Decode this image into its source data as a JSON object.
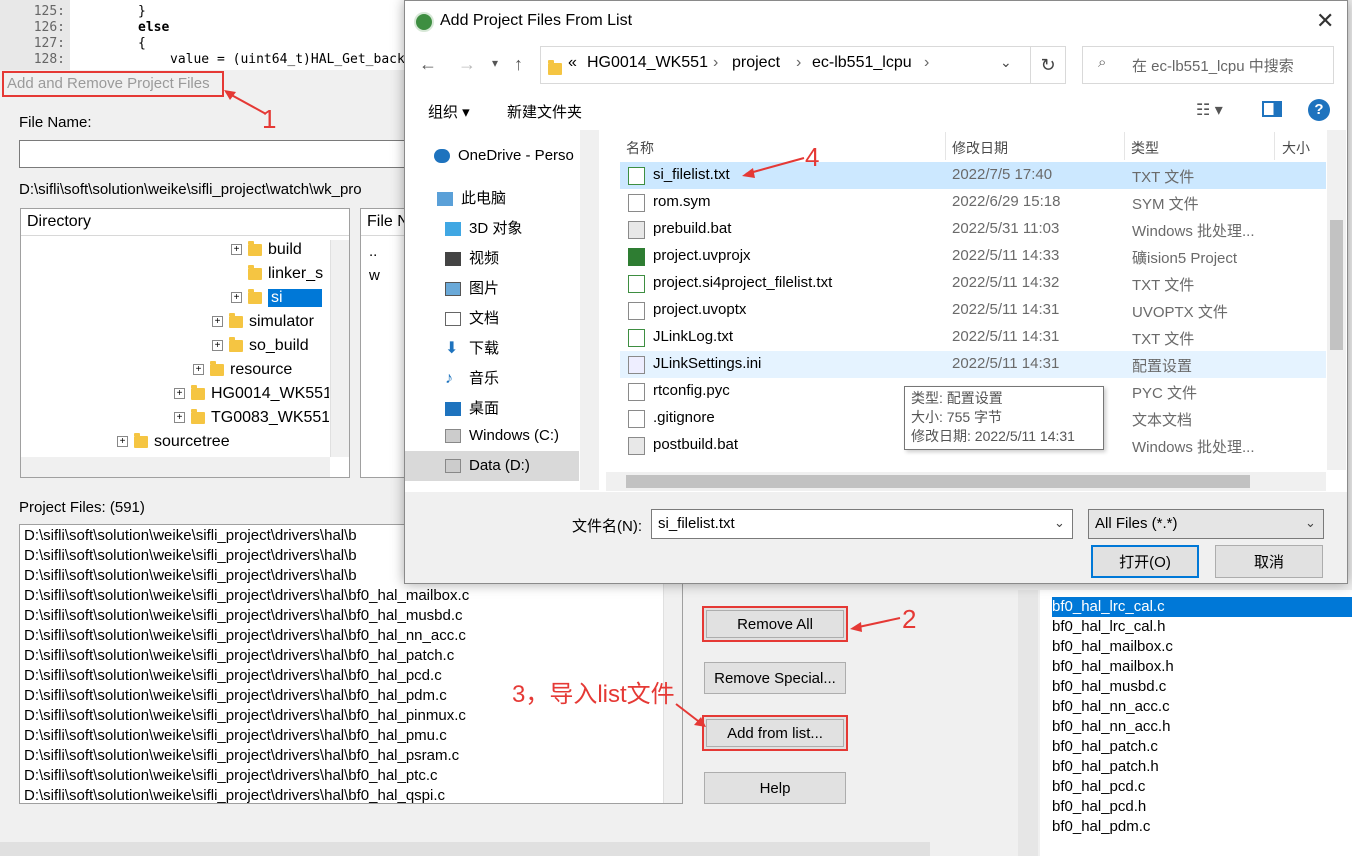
{
  "editor": {
    "lines": [
      {
        "num": "125:",
        "code": "}"
      },
      {
        "num": "126:",
        "code": "else"
      },
      {
        "num": "127:",
        "code": "{"
      },
      {
        "num": "128:",
        "code": "value = (uint64_t)HAL_Get_backu"
      }
    ]
  },
  "main_dialog": {
    "title": "Add and Remove Project Files",
    "file_name_label": "File Name:",
    "file_name_value": "",
    "path": "D:\\sifli\\soft\\solution\\weike\\sifli_project\\watch\\wk_pro",
    "directory_header": "Directory",
    "file_header": "File N",
    "tree": [
      {
        "label": "build",
        "expander": "+"
      },
      {
        "label": "linker_s",
        "expander": ""
      },
      {
        "label": "si",
        "expander": "+",
        "selected": true
      },
      {
        "label": "simulator",
        "expander": "+"
      },
      {
        "label": "so_build",
        "expander": "+"
      },
      {
        "label": "resource",
        "expander": "+"
      },
      {
        "label": "HG0014_WK551",
        "expander": "+"
      },
      {
        "label": "TG0083_WK551",
        "expander": "+"
      },
      {
        "label": "sourcetree",
        "expander": "+"
      }
    ],
    "file_list": [
      "..",
      "w"
    ],
    "project_files_label": "Project Files: (591)",
    "project_files": [
      "D:\\sifli\\soft\\solution\\weike\\sifli_project\\drivers\\hal\\b",
      "D:\\sifli\\soft\\solution\\weike\\sifli_project\\drivers\\hal\\b",
      "D:\\sifli\\soft\\solution\\weike\\sifli_project\\drivers\\hal\\b",
      "D:\\sifli\\soft\\solution\\weike\\sifli_project\\drivers\\hal\\bf0_hal_mailbox.c",
      "D:\\sifli\\soft\\solution\\weike\\sifli_project\\drivers\\hal\\bf0_hal_musbd.c",
      "D:\\sifli\\soft\\solution\\weike\\sifli_project\\drivers\\hal\\bf0_hal_nn_acc.c",
      "D:\\sifli\\soft\\solution\\weike\\sifli_project\\drivers\\hal\\bf0_hal_patch.c",
      "D:\\sifli\\soft\\solution\\weike\\sifli_project\\drivers\\hal\\bf0_hal_pcd.c",
      "D:\\sifli\\soft\\solution\\weike\\sifli_project\\drivers\\hal\\bf0_hal_pdm.c",
      "D:\\sifli\\soft\\solution\\weike\\sifli_project\\drivers\\hal\\bf0_hal_pinmux.c",
      "D:\\sifli\\soft\\solution\\weike\\sifli_project\\drivers\\hal\\bf0_hal_pmu.c",
      "D:\\sifli\\soft\\solution\\weike\\sifli_project\\drivers\\hal\\bf0_hal_psram.c",
      "D:\\sifli\\soft\\solution\\weike\\sifli_project\\drivers\\hal\\bf0_hal_ptc.c",
      "D:\\sifli\\soft\\solution\\weike\\sifli_project\\drivers\\hal\\bf0_hal_qspi.c"
    ],
    "buttons": {
      "remove_all": "Remove All",
      "remove_special": "Remove Special...",
      "add_from_list": "Add from list...",
      "help": "Help"
    }
  },
  "annotations": {
    "n1": "1",
    "n2": "2",
    "n3": "3，导入list文件",
    "n4": "4",
    "color": "#e53935"
  },
  "right_list": [
    "bf0_hal_lrc_cal.c",
    "bf0_hal_lrc_cal.h",
    "bf0_hal_mailbox.c",
    "bf0_hal_mailbox.h",
    "bf0_hal_musbd.c",
    "bf0_hal_nn_acc.c",
    "bf0_hal_nn_acc.h",
    "bf0_hal_patch.c",
    "bf0_hal_patch.h",
    "bf0_hal_pcd.c",
    "bf0_hal_pcd.h",
    "bf0_hal_pdm.c"
  ],
  "file_dialog": {
    "title": "Add Project Files From List",
    "close": "✕",
    "breadcrumbs": [
      "«",
      "HG0014_WK551",
      "project",
      "ec-lb551_lcpu"
    ],
    "search_placeholder": "在 ec-lb551_lcpu 中搜索",
    "organize": "组织 ▾",
    "new_folder": "新建文件夹",
    "nav": [
      {
        "label": "OneDrive - Perso",
        "icon": "cloud-icon"
      },
      {
        "label": "此电脑",
        "icon": "computer-icon"
      },
      {
        "label": "3D 对象",
        "icon": "cube-icon"
      },
      {
        "label": "视频",
        "icon": "video-icon"
      },
      {
        "label": "图片",
        "icon": "picture-icon"
      },
      {
        "label": "文档",
        "icon": "document-icon"
      },
      {
        "label": "下载",
        "icon": "download-icon"
      },
      {
        "label": "音乐",
        "icon": "music-icon"
      },
      {
        "label": "桌面",
        "icon": "desktop-icon"
      },
      {
        "label": "Windows (C:)",
        "icon": "drive-icon"
      },
      {
        "label": "Data (D:)",
        "icon": "drive-icon"
      }
    ],
    "columns": {
      "name": "名称",
      "date": "修改日期",
      "type": "类型",
      "size": "大小"
    },
    "files": [
      {
        "name": "si_filelist.txt",
        "date": "2022/7/5 17:40",
        "type": "TXT 文件"
      },
      {
        "name": "rom.sym",
        "date": "2022/6/29 15:18",
        "type": "SYM 文件"
      },
      {
        "name": "prebuild.bat",
        "date": "2022/5/31 11:03",
        "type": "Windows 批处理..."
      },
      {
        "name": "project.uvprojx",
        "date": "2022/5/11 14:33",
        "type": "礦ision5 Project"
      },
      {
        "name": "project.si4project_filelist.txt",
        "date": "2022/5/11 14:32",
        "type": "TXT 文件"
      },
      {
        "name": "project.uvoptx",
        "date": "2022/5/11 14:31",
        "type": "UVOPTX 文件"
      },
      {
        "name": "JLinkLog.txt",
        "date": "2022/5/11 14:31",
        "type": "TXT 文件"
      },
      {
        "name": "JLinkSettings.ini",
        "date": "2022/5/11 14:31",
        "type": "配置设置"
      },
      {
        "name": "rtconfig.pyc",
        "date": "",
        "type": "PYC 文件"
      },
      {
        "name": ".gitignore",
        "date": "",
        "type": "文本文档"
      },
      {
        "name": "postbuild.bat",
        "date": "",
        "type": "Windows 批处理..."
      }
    ],
    "tooltip": {
      "type": "类型: 配置设置",
      "size": "大小: 755 字节",
      "date": "修改日期: 2022/5/11 14:31"
    },
    "filename_label": "文件名(N):",
    "filename_value": "si_filelist.txt",
    "filter": "All Files (*.*)",
    "open": "打开(O)",
    "cancel": "取消"
  }
}
